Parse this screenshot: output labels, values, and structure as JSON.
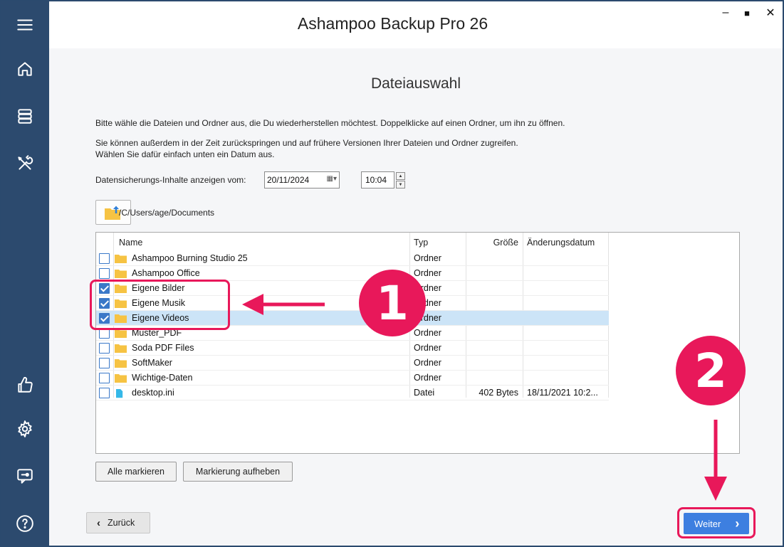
{
  "app": {
    "title": "Ashampoo Backup Pro 26"
  },
  "window_controls": {
    "minimize": "–",
    "maximize": "■",
    "close": "✕"
  },
  "sidebar": {
    "items": [
      {
        "name": "menu-icon"
      },
      {
        "name": "home-icon"
      },
      {
        "name": "storage-icon"
      },
      {
        "name": "tools-icon"
      },
      {
        "name": "thumbs-up-icon"
      },
      {
        "name": "settings-icon"
      },
      {
        "name": "support-icon"
      },
      {
        "name": "help-icon"
      }
    ]
  },
  "page": {
    "title": "Dateiauswahl",
    "intro": "Bitte wähle die Dateien und Ordner aus, die Du wiederherstellen möchtest. Doppelklicke auf einen Ordner, um ihn zu öffnen.",
    "info_line1": "Sie können außerdem in der Zeit zurückspringen und auf frühere Versionen Ihrer Dateien und Ordner zugreifen.",
    "info_line2": "Wählen Sie dafür einfach unten ein Datum aus."
  },
  "date_selector": {
    "label": "Datensicherungs-Inhalte anzeigen vom:",
    "date": "20/11/2024",
    "time": "10:04"
  },
  "path": "/C/Users/age/Documents",
  "table": {
    "headers": {
      "name": "Name",
      "type": "Typ",
      "size": "Größe",
      "modified": "Änderungsdatum"
    },
    "rows": [
      {
        "name": "Ashampoo Burning Studio 25",
        "type": "Ordner",
        "size": "",
        "modified": "",
        "checked": false,
        "kind": "folder"
      },
      {
        "name": "Ashampoo Office",
        "type": "Ordner",
        "size": "",
        "modified": "",
        "checked": false,
        "kind": "folder"
      },
      {
        "name": "Eigene Bilder",
        "type": "Ordner",
        "size": "",
        "modified": "",
        "checked": true,
        "kind": "folder"
      },
      {
        "name": "Eigene Musik",
        "type": "Ordner",
        "size": "",
        "modified": "",
        "checked": true,
        "kind": "folder"
      },
      {
        "name": "Eigene Videos",
        "type": "Ordner",
        "size": "",
        "modified": "",
        "checked": true,
        "kind": "folder",
        "selected": true
      },
      {
        "name": "Muster_PDF",
        "type": "Ordner",
        "size": "",
        "modified": "",
        "checked": false,
        "kind": "folder"
      },
      {
        "name": "Soda PDF Files",
        "type": "Ordner",
        "size": "",
        "modified": "",
        "checked": false,
        "kind": "folder"
      },
      {
        "name": "SoftMaker",
        "type": "Ordner",
        "size": "",
        "modified": "",
        "checked": false,
        "kind": "folder"
      },
      {
        "name": "Wichtige-Daten",
        "type": "Ordner",
        "size": "",
        "modified": "",
        "checked": false,
        "kind": "folder"
      },
      {
        "name": "desktop.ini",
        "type": "Datei",
        "size": "402 Bytes",
        "modified": "18/11/2021 10:2...",
        "checked": false,
        "kind": "file"
      }
    ]
  },
  "buttons": {
    "select_all": "Alle markieren",
    "deselect": "Markierung aufheben",
    "back": "Zurück",
    "next": "Weiter"
  },
  "annotations": {
    "step1": "1",
    "step2": "2"
  },
  "colors": {
    "sidebar": "#2c4a6e",
    "accent": "#3d7fe0",
    "annotation": "#e8185a",
    "folder": "#f6c343",
    "file": "#35b8e8"
  }
}
